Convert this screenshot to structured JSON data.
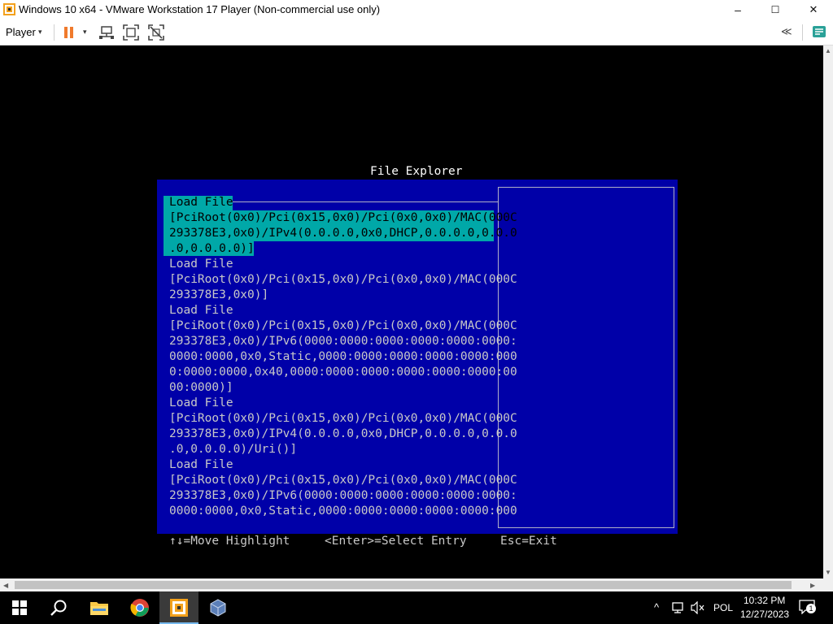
{
  "window": {
    "title": "Windows 10 x64 - VMware Workstation 17 Player (Non-commercial use only)",
    "minimize": "–",
    "maximize": "☐",
    "close": "✕"
  },
  "toolbar": {
    "player_menu": "Player",
    "caret": "▾",
    "collapse": "≪"
  },
  "uefi": {
    "title": "File Explorer",
    "entries": [
      {
        "lines": [
          "Load File",
          "[PciRoot(0x0)/Pci(0x15,0x0)/Pci(0x0,0x0)/MAC(000C",
          "293378E3,0x0)/IPv4(0.0.0.0,0x0,DHCP,0.0.0.0,0.0.0",
          ".0,0.0.0.0)]"
        ],
        "selected": true
      },
      {
        "lines": [
          "Load File",
          "[PciRoot(0x0)/Pci(0x15,0x0)/Pci(0x0,0x0)/MAC(000C",
          "293378E3,0x0)]"
        ],
        "selected": false
      },
      {
        "lines": [
          "Load File",
          "[PciRoot(0x0)/Pci(0x15,0x0)/Pci(0x0,0x0)/MAC(000C",
          "293378E3,0x0)/IPv6(0000:0000:0000:0000:0000:0000:",
          "0000:0000,0x0,Static,0000:0000:0000:0000:0000:000",
          "0:0000:0000,0x40,0000:0000:0000:0000:0000:0000:00",
          "00:0000)]"
        ],
        "selected": false
      },
      {
        "lines": [
          "Load File",
          "[PciRoot(0x0)/Pci(0x15,0x0)/Pci(0x0,0x0)/MAC(000C",
          "293378E3,0x0)/IPv4(0.0.0.0,0x0,DHCP,0.0.0.0,0.0.0",
          ".0,0.0.0.0)/Uri()]"
        ],
        "selected": false
      },
      {
        "lines": [
          "Load File",
          "[PciRoot(0x0)/Pci(0x15,0x0)/Pci(0x0,0x0)/MAC(000C",
          "293378E3,0x0)/IPv6(0000:0000:0000:0000:0000:0000:",
          "0000:0000,0x0,Static,0000:0000:0000:0000:0000:000"
        ],
        "selected": false
      }
    ],
    "footer": {
      "move": "↑↓=Move Highlight",
      "select": "<Enter>=Select Entry",
      "exit": "Esc=Exit"
    },
    "colors": {
      "panel": "#0000a8",
      "highlight": "#00a8a8",
      "text": "#c8c8c8"
    }
  },
  "taskbar": {
    "apps": [
      "start-icon",
      "search-icon",
      "file-explorer-icon",
      "chrome-icon",
      "vmware-player-icon",
      "virtualbox-icon"
    ],
    "tray": {
      "language": "POL",
      "time": "10:32 PM",
      "date": "12/27/2023",
      "notifications": "1"
    }
  }
}
